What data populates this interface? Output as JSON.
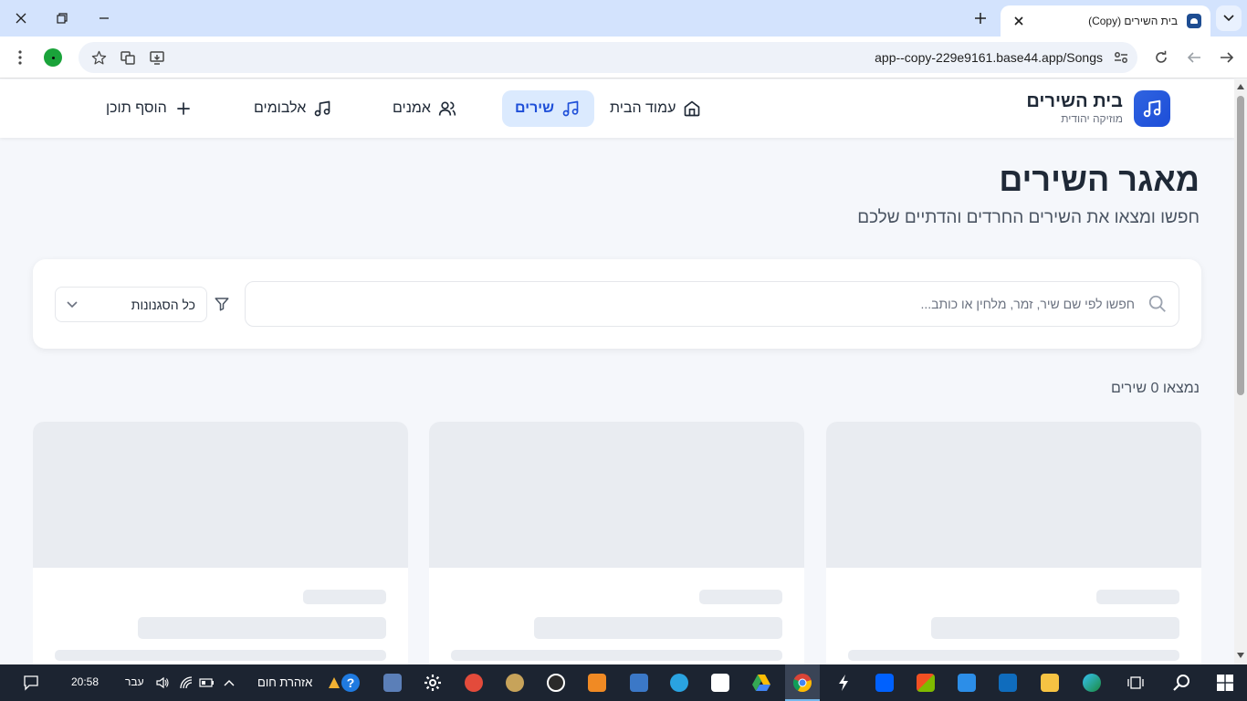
{
  "browser": {
    "tab_title": "בית השירים (Copy)",
    "url": "app--copy-229e9161.base44.app/Songs"
  },
  "app": {
    "brand_title": "בית השירים",
    "brand_subtitle": "מוזיקה יהודית",
    "nav": [
      {
        "label": "עמוד הבית",
        "icon": "home-icon",
        "active": false
      },
      {
        "label": "שירים",
        "icon": "music-note-icon",
        "active": true
      },
      {
        "label": "אמנים",
        "icon": "users-icon",
        "active": false
      },
      {
        "label": "אלבומים",
        "icon": "music-note-icon",
        "active": false
      },
      {
        "label": "הוסף תוכן",
        "icon": "plus-icon",
        "active": false
      }
    ],
    "accent": "#1d4ed8"
  },
  "main": {
    "title": "מאגר השירים",
    "subtitle": "חפשו ומצאו את השירים החרדים והדתיים שלכם",
    "search_placeholder": "חפשו לפי שם שיר, זמר, מלחין או כותב...",
    "genre_value": "כל הסגנונות",
    "results_count": "נמצאו 0 שירים"
  },
  "taskbar": {
    "time": "20:58",
    "language": "עבר",
    "weather": "אזהרת חום"
  }
}
